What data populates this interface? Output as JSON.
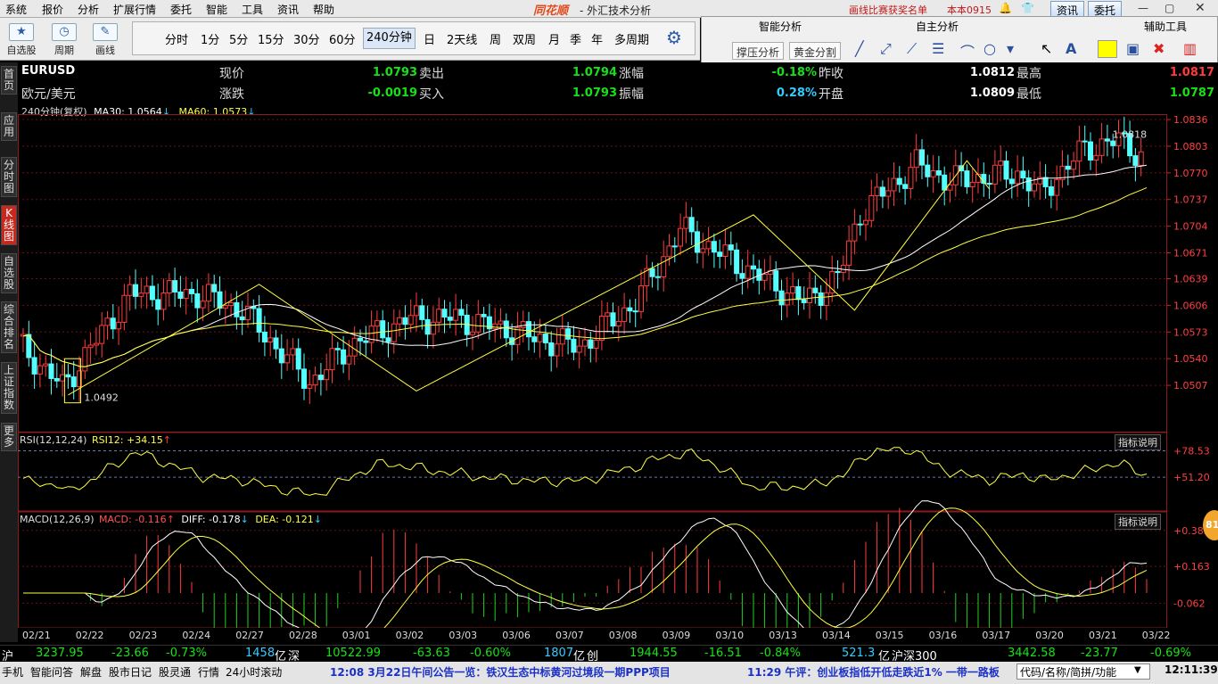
{
  "menu": {
    "items": [
      "系统",
      "报价",
      "分析",
      "扩展行情",
      "委托",
      "智能",
      "工具",
      "资讯",
      "帮助"
    ],
    "logo": "同花顺",
    "title": "- 外汇技术分析",
    "promo": "画线比赛获奖名单",
    "account": "本本0915",
    "btn_news": "资讯",
    "btn_trade": "委托"
  },
  "toolbar": {
    "tools": [
      {
        "label": "自选股",
        "icon": "star-icon"
      },
      {
        "label": "周期",
        "icon": "clock-icon"
      },
      {
        "label": "画线",
        "icon": "pen-icon"
      }
    ],
    "periods": [
      "分时",
      "1分",
      "5分",
      "15分",
      "30分",
      "60分",
      "240分钟",
      "日",
      "2天线",
      "周",
      "双周",
      "月",
      "季",
      "年",
      "多周期"
    ],
    "selected_period": "240分钟"
  },
  "panel": {
    "smart_analysis": "智能分析",
    "self_analysis": "自主分析",
    "aux_tools": "辅助工具",
    "btn_support": "撑压分析",
    "btn_golden": "黄金分割"
  },
  "sidebar": [
    "首页",
    "应用",
    "分时图",
    "K线图",
    "自选股",
    "综合排名",
    "上证指数",
    "更多"
  ],
  "quote": {
    "symbol": "EURUSD",
    "name": "欧元/美元",
    "l_price": "现价",
    "price": "1.0793",
    "l_sell": "卖出",
    "sell": "1.0794",
    "l_change_pct": "涨幅",
    "change_pct": "-0.18%",
    "l_prev": "昨收",
    "prev": "1.0812",
    "l_high": "最高",
    "high": "1.0817",
    "l_change": "涨跌",
    "change": "-0.0019",
    "l_buy": "买入",
    "buy": "1.0793",
    "l_amp": "振幅",
    "amp": "0.28%",
    "l_open": "开盘",
    "open": "1.0809",
    "l_low": "最低",
    "low": "1.0787"
  },
  "main_indicator": {
    "period_label": "240分钟(复权)",
    "ma30_label": "MA30: 1.0564",
    "ma60_label": "MA60: 1.0573"
  },
  "rsi": {
    "label": "RSI(12,12,24)",
    "value": "RSI12: +34.15",
    "explain": "指标说明"
  },
  "macd": {
    "label": "MACD(12,26,9)",
    "macd": "MACD: -0.116",
    "diff": "DIFF: -0.178",
    "dea": "DEA: -0.121",
    "explain": "指标说明"
  },
  "chart_data": {
    "type": "candlestick",
    "y_ticks": [
      "1.0836",
      "1.0803",
      "1.0770",
      "1.0737",
      "1.0704",
      "1.0671",
      "1.0639",
      "1.0606",
      "1.0573",
      "1.0540",
      "1.0507"
    ],
    "ylim": [
      1.0474,
      1.0836
    ],
    "annotations": {
      "high": "1.0818",
      "low": "1.0492"
    },
    "x_ticks": [
      "02/21",
      "02/22",
      "02/23",
      "02/24",
      "02/27",
      "02/28",
      "03/01",
      "03/02",
      "03/03",
      "03/06",
      "03/07",
      "03/08",
      "03/09",
      "03/10",
      "03/13",
      "03/14",
      "03/15",
      "03/16",
      "03/17",
      "03/20",
      "03/21",
      "03/22"
    ],
    "rsi_ticks": [
      "+78.53",
      "+51.20"
    ],
    "macd_ticks": [
      "+0.383",
      "+0.163",
      "-0.062"
    ]
  },
  "status": {
    "sh_label": "沪",
    "sh_idx": "3237.95",
    "sh_chg": "-23.66",
    "sh_pct": "-0.73%",
    "sh_amt": "1458",
    "sh_unit": "亿",
    "sz_label": "深",
    "sz_idx": "10522.99",
    "sz_chg": "-63.63",
    "sz_pct": "-0.60%",
    "sz_amt": "1807",
    "sz_unit": "亿",
    "cy_label": "创",
    "cy_idx": "1944.55",
    "cy_chg": "-16.51",
    "cy_pct": "-0.84%",
    "cy_amt": "521.3",
    "cy_unit": "亿",
    "hs_label": "沪深300",
    "hs_idx": "3442.58",
    "hs_chg": "-23.77",
    "hs_pct": "-0.69%"
  },
  "footer": {
    "tabs": [
      "手机",
      "智能问答",
      "解盘",
      "股市日记",
      "股灵通",
      "行情",
      "24小时滚动"
    ],
    "news1": "12:08 3月22日午间公告一览：铁汉生态中标黄河过境段一期PPP项目",
    "news2": "11:29 午评：创业板指低开低走跌近1% 一带一路板",
    "search": "代码/名称/简拼/功能",
    "time": "12:11:39"
  },
  "badge": "81"
}
